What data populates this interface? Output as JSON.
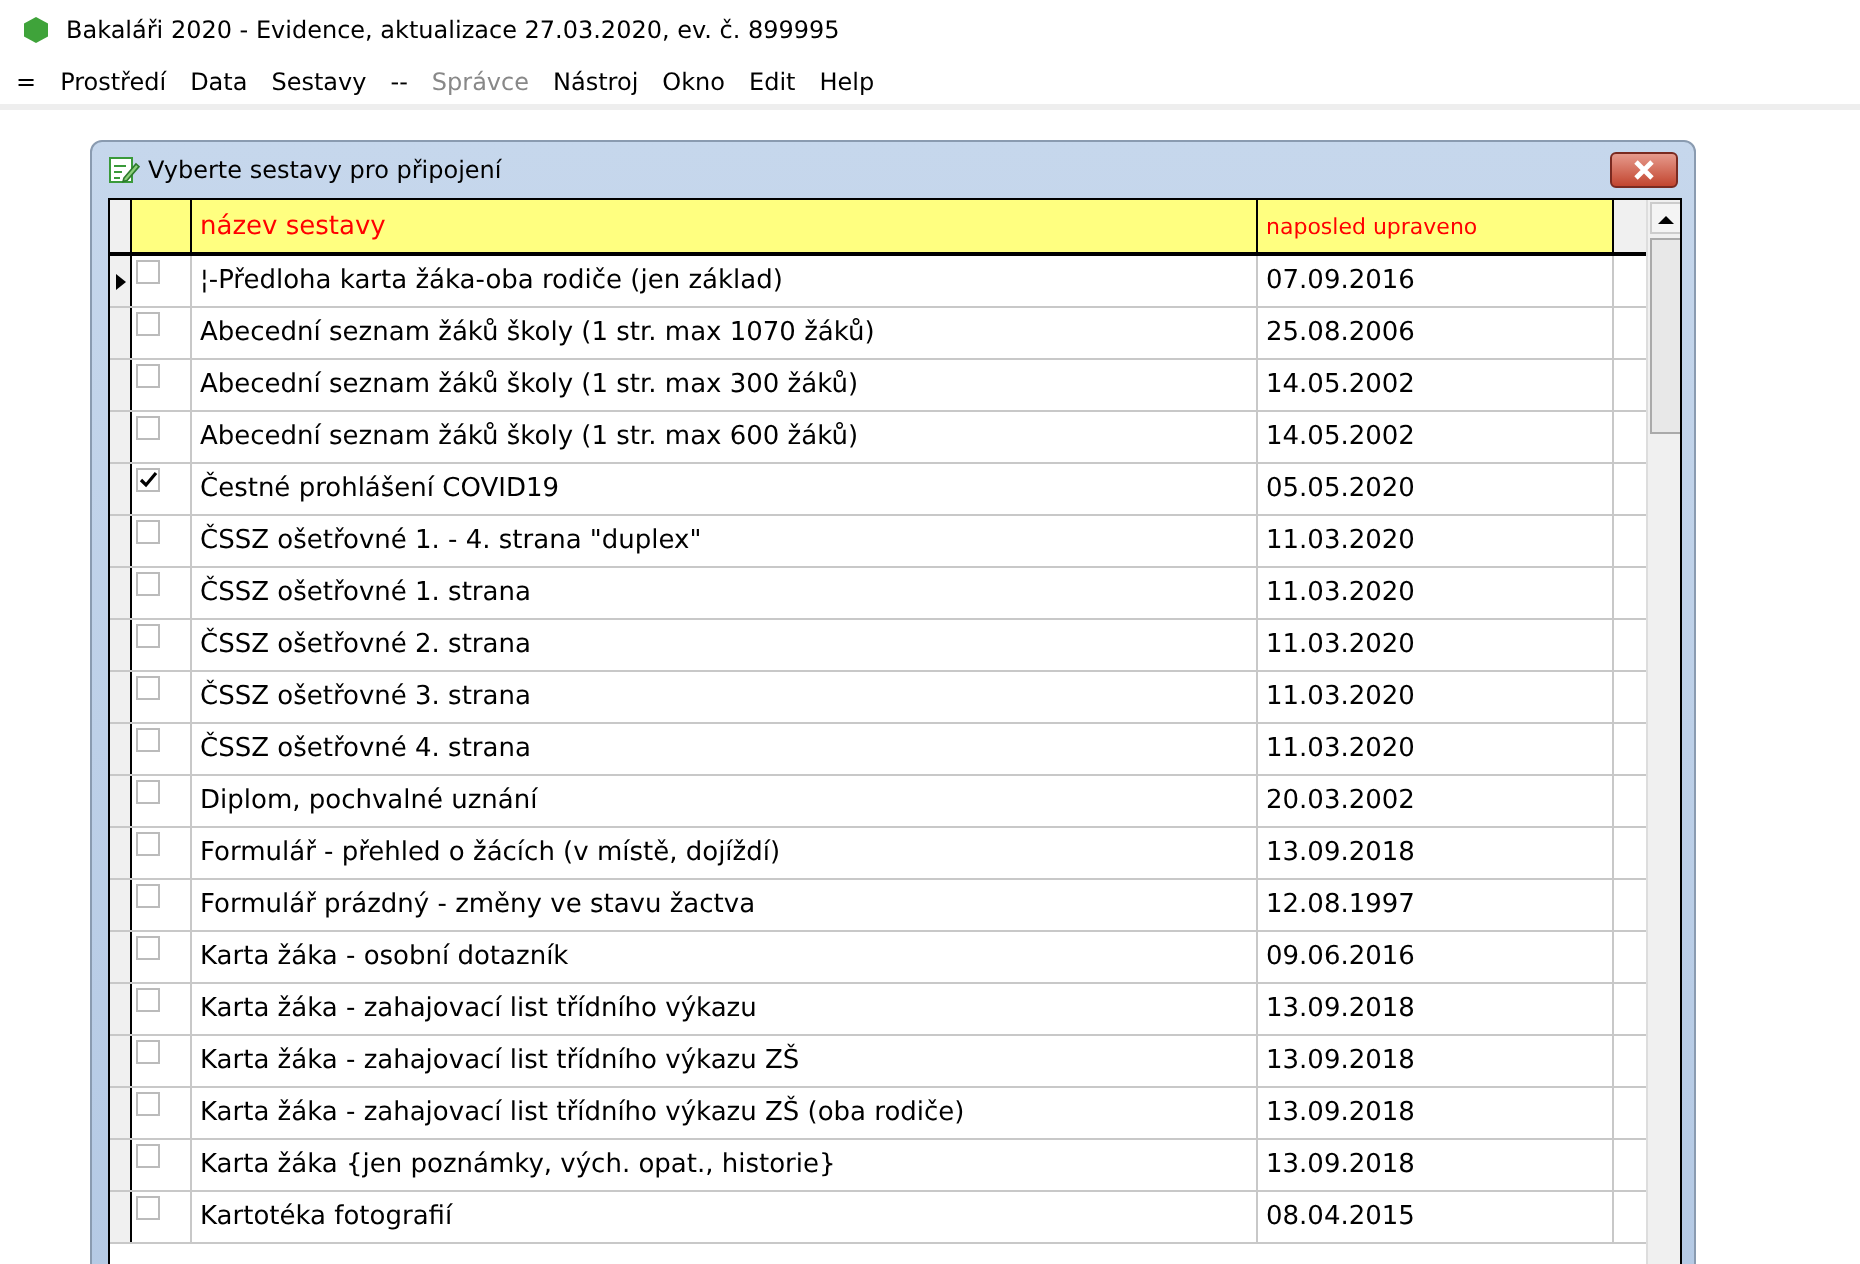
{
  "window": {
    "title": "Bakaláři 2020 - Evidence, aktualizace 27.03.2020, ev. č. 899995"
  },
  "menu": [
    {
      "label": "=",
      "disabled": false
    },
    {
      "label": "Prostředí",
      "disabled": false
    },
    {
      "label": "Data",
      "disabled": false
    },
    {
      "label": "Sestavy",
      "disabled": false
    },
    {
      "label": "--",
      "disabled": false
    },
    {
      "label": "Správce",
      "disabled": true
    },
    {
      "label": "Nástroj",
      "disabled": false
    },
    {
      "label": "Okno",
      "disabled": false
    },
    {
      "label": "Edit",
      "disabled": false
    },
    {
      "label": "Help",
      "disabled": false
    }
  ],
  "dialog": {
    "title": "Vyberte sestavy pro připojení",
    "table": {
      "columns": [
        "název sestavy",
        "naposled upraveno"
      ],
      "rows": [
        {
          "name": "¦-Předloha karta žáka-oba rodiče (jen základ)",
          "date": "07.09.2016",
          "checked": false,
          "current": true
        },
        {
          "name": "Abecední seznam žáků školy (1 str. max 1070 žáků)",
          "date": "25.08.2006",
          "checked": false,
          "current": false
        },
        {
          "name": "Abecední seznam žáků školy (1 str. max 300 žáků)",
          "date": "14.05.2002",
          "checked": false,
          "current": false
        },
        {
          "name": "Abecední seznam žáků školy (1 str. max 600 žáků)",
          "date": "14.05.2002",
          "checked": false,
          "current": false
        },
        {
          "name": "Čestné prohlášení COVID19",
          "date": "05.05.2020",
          "checked": true,
          "current": false
        },
        {
          "name": "ČSSZ ošetřovné 1. - 4. strana \"duplex\"",
          "date": "11.03.2020",
          "checked": false,
          "current": false
        },
        {
          "name": "ČSSZ ošetřovné 1. strana",
          "date": "11.03.2020",
          "checked": false,
          "current": false
        },
        {
          "name": "ČSSZ ošetřovné 2. strana",
          "date": "11.03.2020",
          "checked": false,
          "current": false
        },
        {
          "name": "ČSSZ ošetřovné 3. strana",
          "date": "11.03.2020",
          "checked": false,
          "current": false
        },
        {
          "name": "ČSSZ ošetřovné 4. strana",
          "date": "11.03.2020",
          "checked": false,
          "current": false
        },
        {
          "name": "Diplom, pochvalné uznání",
          "date": "20.03.2002",
          "checked": false,
          "current": false
        },
        {
          "name": "Formulář - přehled o žácích (v místě, dojíždí)",
          "date": "13.09.2018",
          "checked": false,
          "current": false
        },
        {
          "name": "Formulář prázdný - změny ve stavu žactva",
          "date": "12.08.1997",
          "checked": false,
          "current": false
        },
        {
          "name": "Karta žáka - osobní dotazník",
          "date": "09.06.2016",
          "checked": false,
          "current": false
        },
        {
          "name": "Karta žáka - zahajovací list třídního výkazu",
          "date": "13.09.2018",
          "checked": false,
          "current": false
        },
        {
          "name": "Karta žáka - zahajovací list třídního výkazu ZŠ",
          "date": "13.09.2018",
          "checked": false,
          "current": false
        },
        {
          "name": "Karta žáka - zahajovací list třídního výkazu ZŠ (oba rodiče)",
          "date": "13.09.2018",
          "checked": false,
          "current": false
        },
        {
          "name": "Karta žáka {jen poznámky, vých. opat., historie}",
          "date": "13.09.2018",
          "checked": false,
          "current": false
        },
        {
          "name": "Kartotéka fotografií",
          "date": "08.04.2015",
          "checked": false,
          "current": false
        }
      ]
    }
  }
}
